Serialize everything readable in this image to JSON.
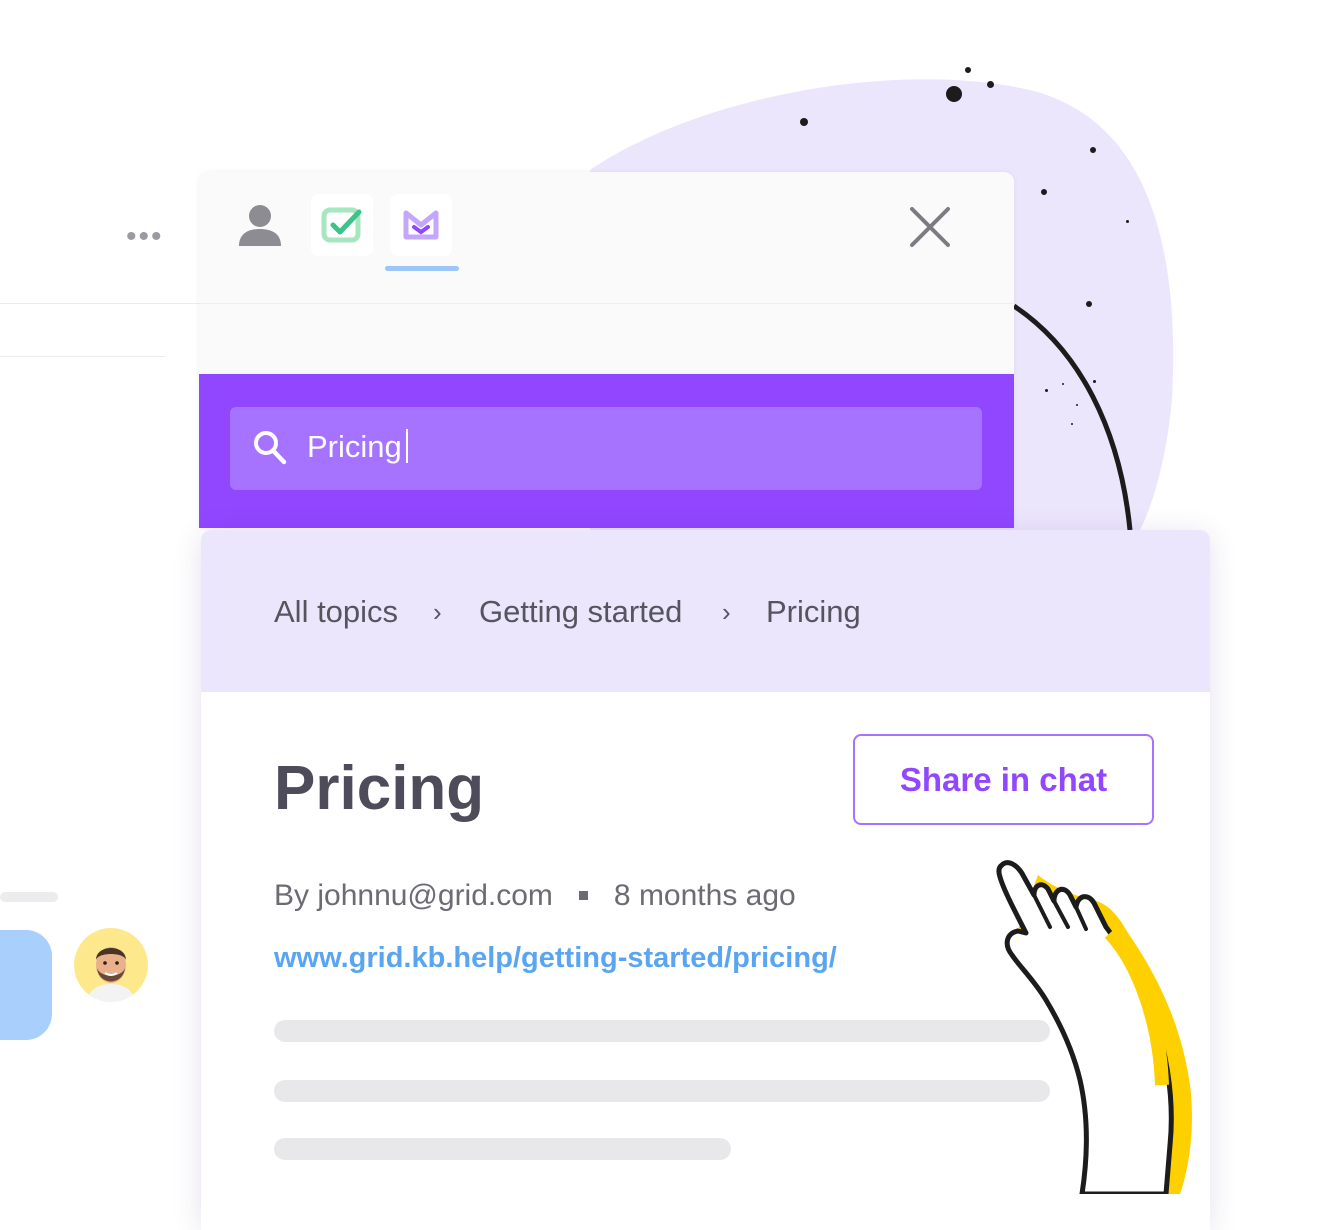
{
  "widget": {
    "tabs": [
      {
        "name": "profile",
        "icon": "person-icon"
      },
      {
        "name": "tasks",
        "icon": "checkbox-icon"
      },
      {
        "name": "knowledge-base",
        "icon": "kb-icon"
      }
    ],
    "active_tab": "knowledge-base",
    "close_icon": "close-icon"
  },
  "search": {
    "icon": "search-icon",
    "value": "Pricing"
  },
  "breadcrumb": {
    "items": [
      "All topics",
      "Getting started",
      "Pricing"
    ],
    "separator": "›"
  },
  "article": {
    "title": "Pricing",
    "share_label": "Share in chat",
    "author": "By johnnu@grid.com",
    "age": "8 months ago",
    "url": "www.grid.kb.help/getting-started/pricing/"
  },
  "colors": {
    "brand": "#9147ff",
    "search_field": "#a573ff",
    "breadcrumb_bg": "#ece6fd",
    "link": "#5aa5f2",
    "blob": "#ece6fd",
    "hand": "#ffd000"
  }
}
